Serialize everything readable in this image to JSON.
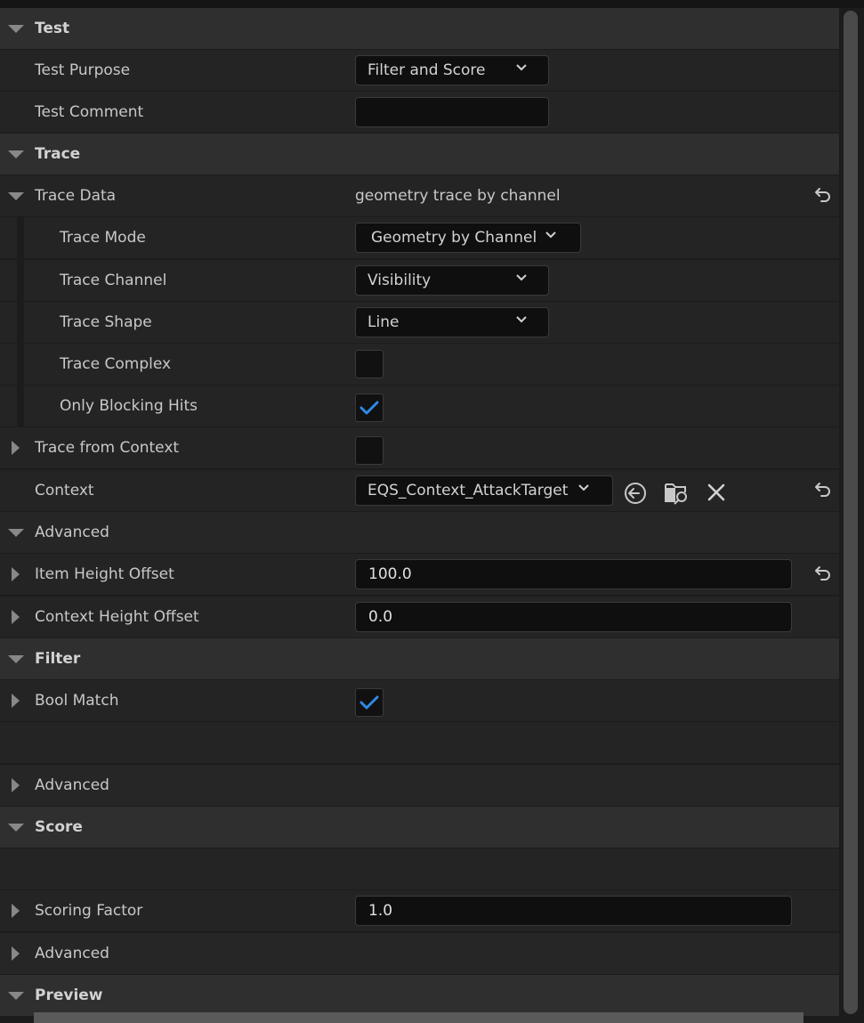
{
  "sections": {
    "test": "Test",
    "trace": "Trace",
    "advanced_trace": "Advanced",
    "filter": "Filter",
    "advanced_filter": "Advanced",
    "score": "Score",
    "advanced_score": "Advanced",
    "preview": "Preview"
  },
  "test_purpose": {
    "label": "Test Purpose",
    "value": "Filter and Score"
  },
  "test_comment": {
    "label": "Test Comment",
    "value": ""
  },
  "trace_data": {
    "label": "Trace Data",
    "value": "geometry trace by channel"
  },
  "trace_mode": {
    "label": "Trace Mode",
    "value": "Geometry by Channel"
  },
  "trace_channel": {
    "label": "Trace Channel",
    "value": "Visibility"
  },
  "trace_shape": {
    "label": "Trace Shape",
    "value": "Line"
  },
  "trace_complex": {
    "label": "Trace Complex",
    "checked": false
  },
  "only_blocking_hits": {
    "label": "Only Blocking Hits",
    "checked": true
  },
  "trace_from_context": {
    "label": "Trace from Context",
    "checked": false
  },
  "context": {
    "label": "Context",
    "value": "EQS_Context_AttackTarget"
  },
  "item_height_offset": {
    "label": "Item Height Offset",
    "value": "100.0"
  },
  "context_height_offset": {
    "label": "Context Height Offset",
    "value": "0.0"
  },
  "bool_match": {
    "label": "Bool Match",
    "checked": true
  },
  "scoring_factor": {
    "label": "Scoring Factor",
    "value": "1.0"
  },
  "colors": {
    "accent_check": "#2f8ae6",
    "section_bg": "#2f2f2f",
    "row_bg": "#242424",
    "input_bg": "#0f0f0f"
  },
  "icons": {
    "expand": "triangle-down-icon",
    "collapse": "triangle-right-icon",
    "reset": "reset-to-default-icon",
    "use_selected": "use-selected-arrow-icon",
    "browse": "browse-folder-icon",
    "clear": "clear-x-icon"
  }
}
